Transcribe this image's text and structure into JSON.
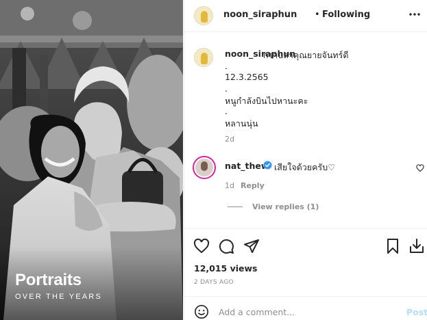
{
  "header": {
    "username": "noon_siraphun",
    "separator": "•",
    "follow_label": "Following",
    "more_icon": "more-horizontal-icon"
  },
  "photo": {
    "watermark_title": "Portraits",
    "watermark_subtitle": "OVER THE YEARS"
  },
  "caption": {
    "username": "noon_siraphun",
    "text": "กราบลาคุณยายจันทร์ดี",
    "lines": [
      ".",
      "12.3.2565",
      ".",
      "หนูกำลังบินไปหานะคะ",
      ".",
      "หลานนุ่น"
    ],
    "time": "2d"
  },
  "comment": {
    "username": "nat_thew",
    "verified_icon": "verified-badge-icon",
    "text": "เสียใจด้วยครับ♡",
    "time": "1d",
    "reply_label": "Reply",
    "view_replies_label": "View replies (1)"
  },
  "actions": {
    "views": "12,015 views",
    "date": "2 DAYS AGO"
  },
  "add_comment": {
    "placeholder": "Add a comment...",
    "post_label": "Post"
  },
  "colors": {
    "accent_post": "#b2dffc",
    "verified": "#3897f0",
    "secondary_text": "#8e8e8e"
  }
}
